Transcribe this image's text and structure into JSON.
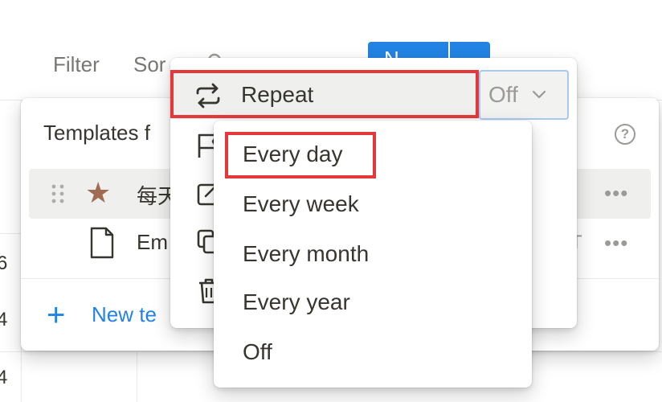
{
  "toolbar": {
    "filter_label": "Filter",
    "sort_label": "Sor",
    "new_label": "N"
  },
  "background": {
    "row_numbers": [
      "6",
      "4",
      "4"
    ]
  },
  "templates": {
    "title": "Templates f",
    "items": [
      {
        "label": "每天",
        "icon": "star-icon"
      },
      {
        "label": "Em",
        "icon": "page-icon",
        "right_text": "T"
      }
    ],
    "new_template_label": "New te",
    "help_label": "?"
  },
  "context_menu": {
    "repeat_label": "Repeat",
    "repeat_value": "Off",
    "icons": [
      "repeat-icon",
      "flag-icon",
      "edit-icon",
      "duplicate-icon",
      "trash-icon"
    ]
  },
  "repeat_options": {
    "items": [
      "Every day",
      "Every week",
      "Every month",
      "Every year",
      "Off"
    ],
    "highlighted": "Every day"
  },
  "colors": {
    "accent_blue": "#2383e2",
    "highlight_red": "#e5383b",
    "star_brown": "#9f6b53",
    "hover_gray": "#efefee"
  }
}
